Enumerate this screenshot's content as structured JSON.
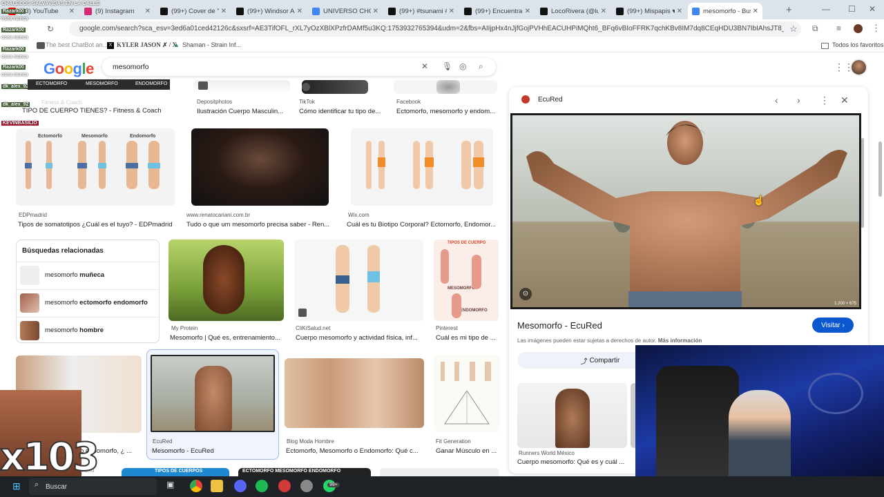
{
  "browser": {
    "tabs": [
      {
        "label": "(43) YouTube",
        "color": "#ff0000"
      },
      {
        "label": "(9) Instagram",
        "color": "#d62976"
      },
      {
        "label": "(99+) Cover de \"V",
        "color": "#111111"
      },
      {
        "label": "(99+) Windsor An",
        "color": "#111111"
      },
      {
        "label": "UNIVERSO CHOW",
        "color": "#4285f4"
      },
      {
        "label": "(99+) #tsunami #",
        "color": "#111111"
      },
      {
        "label": "(99+) Encuentra",
        "color": "#111111"
      },
      {
        "label": "LocoRivera (@lui",
        "color": "#111111"
      },
      {
        "label": "(99+) Mispapis ♥",
        "color": "#111111"
      },
      {
        "label": "mesomorfo - Bus",
        "color": "#4285f4"
      }
    ],
    "url": "google.com/search?sca_esv=3ed6a01ced42126c&sxsrf=AE3TifOFL_rXL7yOzXBlXPzfrDAMf5u3KQ:1753932765394&udm=2&fbs=AIIjpHx4nJjfGojPVHhEACUHPiMQht6_BFq6vBIoFFRK7qchKBv8IM7dq8CEqHDU3BN7IbIAhsJT8_A_Kaclg0ioopJQE57ZvFQV...",
    "bookmarks": [
      "The best ChatBot an...",
      "KYLER JASON ✗ / X",
      "Shaman - Strain Inf...",
      "Todos los favoritos"
    ]
  },
  "google": {
    "logo": "Google",
    "query": "mesomorfo"
  },
  "overlay": {
    "chat_header": "CHALECOS SALVAVIDAS EN LA CALLE",
    "chat": [
      {
        "user": "Razark00",
        "msg": "osea nunca"
      },
      {
        "user": "Razark00",
        "msg": "osea nunca"
      },
      {
        "user": "Razark00",
        "msg": "osea nunca"
      },
      {
        "user": "Razark00",
        "msg": "osea nunca"
      },
      {
        "user": "dk_alex_92",
        "msg": ""
      },
      {
        "user": "dk_alex_92",
        "msg": ""
      },
      {
        "user": "KEVINBASILIO",
        "msg": ""
      }
    ],
    "filter_chips": [
      "ECTOMORFO",
      "MESOMORFO",
      "ENDOMORFO"
    ],
    "multiplier": "x103"
  },
  "results": {
    "row0": [
      {
        "source": "Fitness & Coach",
        "title": "TIPO DE CUERPO TIENES? - Fitness & Coach"
      },
      {
        "source": "Depositphotos",
        "title": "Ilustración Cuerpo Masculin..."
      },
      {
        "source": "TikTok",
        "title": "Cómo identificar tu tipo de..."
      },
      {
        "source": "Facebook",
        "title": "Ectomorfo, mesomorfo y endom..."
      }
    ],
    "row1": [
      {
        "source": "EDPmadrid",
        "title": "Tipos de somatotipos ¿Cuál es el tuyo? - EDPmadrid",
        "labels": [
          "Ectomorfo",
          "Mesomorfo",
          "Endomorfo"
        ]
      },
      {
        "source": "www.renatocariani.com.br",
        "title": "Tudo o que um mesomorfo precisa saber - Ren..."
      },
      {
        "source": "Wix.com",
        "title": "Cuál es tu Biotipo Corporal? Ectomorfo, Endomor..."
      }
    ],
    "related": {
      "heading": "Búsquedas relacionadas",
      "items": [
        {
          "base": "mesomorfo",
          "bold": "muñeca"
        },
        {
          "base": "mesomorfo",
          "bold": "ectomorfo endomorfo"
        },
        {
          "base": "mesomorfo",
          "bold": "hombre"
        }
      ]
    },
    "row2": [
      {
        "source": "My Protein",
        "title": "Mesomorfo | Qué es, entrenamiento..."
      },
      {
        "source": "CliKiSalud.net",
        "title": "Cuerpo mesomorfo y actividad física, inf..."
      },
      {
        "source": "Pinterest",
        "title": "Cuál es mi tipo de ...",
        "poster_top": "TIPOS DE CUERPO",
        "poster_mid": "MESOMORFO",
        "poster_bottom": "ENDOMORFO"
      }
    ],
    "row3": [
      {
        "source": "",
        "title": "o endomorfo, ¿ ..."
      },
      {
        "source": "EcuRed",
        "title": "Mesomorfo - EcuRed"
      },
      {
        "source": "Blog Moda Hombre",
        "title": "Ectomorfo, Mesomorfo o Endomorfo: Qué c..."
      },
      {
        "source": "Fit Generation",
        "title": "Ganar Músculo en ..."
      }
    ],
    "row4_labels": [
      "TIPOS DE CUERPOS",
      "ECTOMORFO  MESOMORFO  ENDOMORFO"
    ],
    "partial_label": "morfo"
  },
  "panel": {
    "site": "EcuRed",
    "title": "Mesomorfo - EcuRed",
    "visit_label": "Visitar",
    "note": "Las imágenes pueden estar sujetas a derechos de autor.",
    "note_link": "Más información",
    "share_label": "Compartir",
    "image_size": "1.200 × 675",
    "related_source": "Runners World México",
    "related_title": "Cuerpo mesomorfo: Qué es y cuál ..."
  },
  "taskbar": {
    "search_placeholder": "Buscar",
    "badge": "99+"
  },
  "colors": {
    "accent": "#0b57d0",
    "tabbar": "#dde3ea"
  }
}
